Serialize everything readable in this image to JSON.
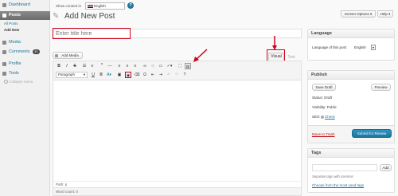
{
  "sidebar": {
    "items": [
      {
        "label": "Dashboard",
        "icon": "dashboard-icon"
      },
      {
        "label": "Posts",
        "icon": "pin-icon",
        "active": true
      },
      {
        "label": "Media",
        "icon": "media-icon"
      },
      {
        "label": "Comments",
        "icon": "comment-icon",
        "badge": "30"
      },
      {
        "label": "Profile",
        "icon": "user-icon"
      },
      {
        "label": "Tools",
        "icon": "tools-icon"
      }
    ],
    "submenu": [
      "All Posts",
      "Add New"
    ],
    "collapse_label": "Collapse menu"
  },
  "topbar": {
    "show_content_label": "Show content in",
    "language_selected": "English",
    "screen_options": "Screen Options",
    "help": "Help"
  },
  "page": {
    "title": "Add New Post",
    "title_placeholder": "Enter title here"
  },
  "editor": {
    "add_media": "Add Media",
    "tab_visual": "Visual",
    "tab_text": "Text",
    "format_select": "Paragraph",
    "path_label": "Path: p",
    "word_count": "Word count: 0"
  },
  "language_box": {
    "title": "Language",
    "label": "Language of this post",
    "value": "English"
  },
  "publish_box": {
    "title": "Publish",
    "save_draft": "Save Draft",
    "preview": "Preview",
    "status": "Status: Draft",
    "visibility": "Visibility: Public",
    "seo_label": "SEO",
    "seo_check": "Check",
    "trash": "Move to Trash",
    "submit": "Submit for Review"
  },
  "tags_box": {
    "title": "Tags",
    "add_button": "Add",
    "hint": "Separate tags with commas",
    "choose_link": "Choose from the most used tags"
  },
  "colors": {
    "highlight": "#d0021b",
    "link": "#21759b",
    "primary": "#21759b",
    "trash": "#bc0b0b"
  }
}
